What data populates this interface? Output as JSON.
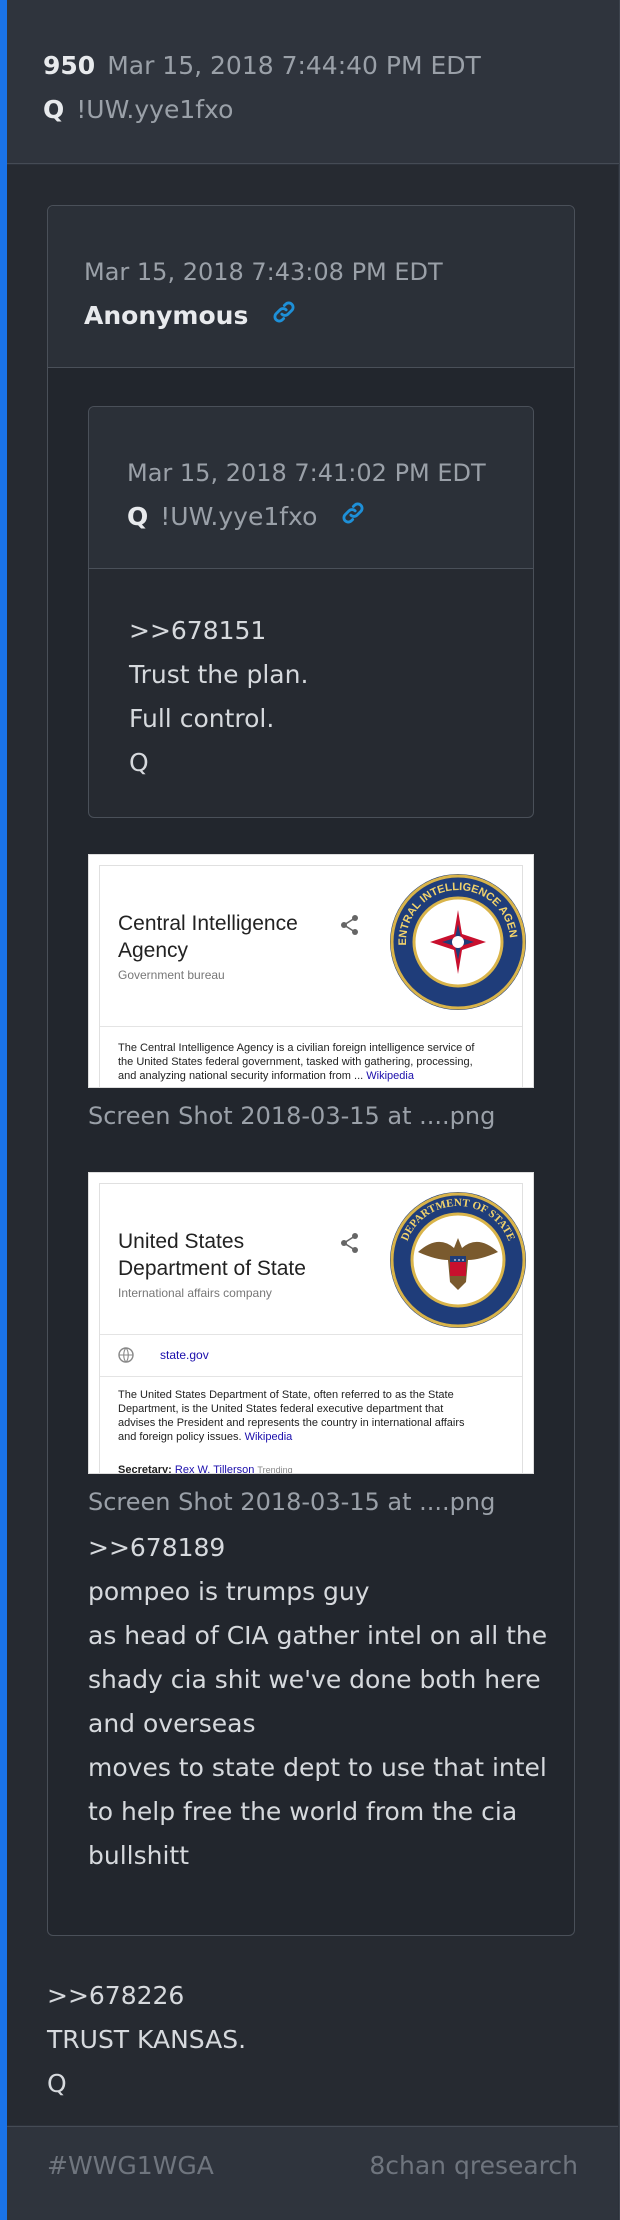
{
  "post": {
    "number": "950",
    "date": "Mar 15, 2018 7:44:40 PM EDT",
    "name": "Q",
    "tripcode": "!UW.yye1fxo"
  },
  "quote": {
    "date": "Mar 15, 2018 7:43:08 PM EDT",
    "name": "Anonymous",
    "nested": {
      "date": "Mar 15, 2018 7:41:02 PM EDT",
      "name": "Q",
      "tripcode": "!UW.yye1fxo",
      "lines": [
        ">>678151",
        "Trust the plan.",
        "Full control.",
        "Q"
      ]
    },
    "attachments": [
      {
        "caption": "Screen Shot 2018-03-15 at ....png",
        "title_line1": "Central Intelligence",
        "title_line2": "Agency",
        "subtitle": "Government bureau",
        "desc_line1": "The Central Intelligence Agency is a civilian foreign intelligence service of",
        "desc_line2": "the United States federal government, tasked with gathering, processing,",
        "desc_line3": "and analyzing national security information from ...",
        "desc_link": "Wikipedia",
        "seal_text": "CENTRAL INTELLIGENCE AGENCY"
      },
      {
        "caption": "Screen Shot 2018-03-15 at ....png",
        "title_line1": "United States",
        "title_line2": "Department of State",
        "subtitle": "International affairs company",
        "website": "state.gov",
        "desc_line1": "The United States Department of State, often referred to as the State",
        "desc_line2": "Department, is the United States federal executive department that",
        "desc_line3": "advises the President and represents the country in international affairs",
        "desc_line4": "and foreign policy issues.",
        "desc_link": "Wikipedia",
        "secretary_label": "Secretary:",
        "secretary_name": "Rex W. Tillerson",
        "trending": "Trending",
        "seal_text": "DEPARTMENT OF STATE"
      }
    ],
    "lines": [
      ">>678189",
      "pompeo is trumps guy",
      "as head of CIA gather intel on all the",
      "shady cia shit we've done both here",
      "and overseas",
      "moves to state dept to use that intel",
      "to help free the world from the cia",
      "bullshitt"
    ]
  },
  "lines": [
    ">>678226",
    "TRUST KANSAS.",
    "Q"
  ],
  "footer": {
    "hashtag": "#WWG1WGA",
    "source": "8chan qresearch"
  },
  "colors": {
    "accent": "#1a73e8",
    "link": "#1e90d8"
  }
}
